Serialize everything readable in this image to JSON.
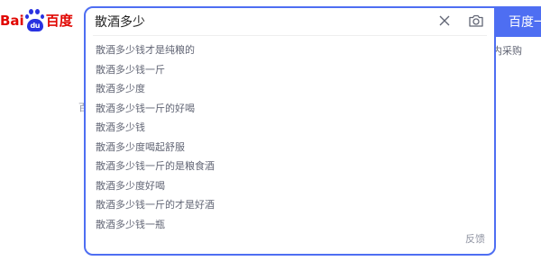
{
  "logo": {
    "text_latin": "Bai",
    "text_paw": "du",
    "text_cn": "百度"
  },
  "search": {
    "value": "散酒多少",
    "button_label": "百度一"
  },
  "suggestions": [
    "散酒多少钱才是纯粮的",
    "散酒多少钱一斤",
    "散酒多少度",
    "散酒多少钱一斤的好喝",
    "散酒多少钱",
    "散酒多少度喝起舒服",
    "散酒多少钱一斤的是粮食酒",
    "散酒多少度好喝",
    "散酒多少钱一斤的才是好酒",
    "散酒多少钱一瓶"
  ],
  "feedback_label": "反馈",
  "background": {
    "link_text": "内采购",
    "fragment_text": "百"
  },
  "colors": {
    "accent": "#4e6ef2",
    "logo_red": "#e10601",
    "logo_blue": "#2932e1",
    "suggestion_text": "#626675",
    "muted": "#9195a3"
  },
  "icons": {
    "clear": "close-icon",
    "camera": "camera-icon"
  }
}
